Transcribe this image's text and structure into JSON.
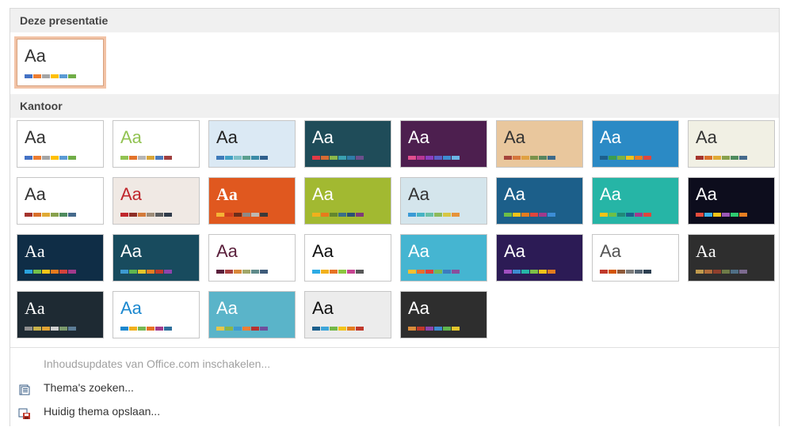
{
  "sections": {
    "current": "Deze presentatie",
    "office": "Kantoor"
  },
  "themes": [
    {
      "aa": "Aa",
      "bg": "#ffffff",
      "fg": "#333333",
      "sw": [
        "#4472c4",
        "#ed7d31",
        "#a5a5a5",
        "#ffc000",
        "#5b9bd5",
        "#70ad47"
      ]
    },
    {
      "aa": "Aa",
      "bg": "#ffffff",
      "fg": "#333333",
      "sw": [
        "#4472c4",
        "#ed7d31",
        "#a5a5a5",
        "#ffc000",
        "#5b9bd5",
        "#70ad47"
      ]
    },
    {
      "aa": "Aa",
      "bg": "#ffffff",
      "fg": "#92c353",
      "sw": [
        "#92c353",
        "#e3732b",
        "#b5b5b5",
        "#d8a63a",
        "#4b7bbc",
        "#9f3f3f"
      ]
    },
    {
      "aa": "Aa",
      "bg": "#dbe9f4",
      "fg": "#222222",
      "sw": [
        "#3e7ab9",
        "#41a0c4",
        "#7cbfc7",
        "#5b9f8f",
        "#3b8ba6",
        "#2f5f8c"
      ]
    },
    {
      "aa": "Aa",
      "bg": "#1f4c59",
      "fg": "#ffffff",
      "sw": [
        "#e23a45",
        "#d76b32",
        "#8bb84b",
        "#3aa0b0",
        "#2e7ca8",
        "#6c4f8c"
      ]
    },
    {
      "aa": "Aa",
      "bg": "#4d1f4f",
      "fg": "#ffffff",
      "sw": [
        "#e04f8e",
        "#b73694",
        "#8a3fc1",
        "#5a60c8",
        "#3d8dd1",
        "#6bb5e6"
      ]
    },
    {
      "aa": "Aa",
      "bg": "#e9c79d",
      "fg": "#333333",
      "sw": [
        "#a5443b",
        "#d6773b",
        "#e0a142",
        "#7b934b",
        "#56855f",
        "#3d6a8a"
      ]
    },
    {
      "aa": "Aa",
      "bg": "#2b8ac5",
      "fg": "#ffffff",
      "sw": [
        "#1c5f8c",
        "#3b9e4f",
        "#7cb342",
        "#f2c318",
        "#ef7c1e",
        "#e0463c"
      ]
    },
    {
      "aa": "Aa",
      "bg": "#f1f0e4",
      "fg": "#333333",
      "sw": [
        "#a5342d",
        "#d96f2a",
        "#e0aa34",
        "#88a14c",
        "#4f8b5e",
        "#466a8c"
      ]
    },
    {
      "aa": "Aa",
      "bg": "#ffffff",
      "fg": "#333333",
      "sw": [
        "#a5342d",
        "#d96f2a",
        "#e0aa34",
        "#88a14c",
        "#4f8b5e",
        "#466a8c"
      ]
    },
    {
      "aa": "Aa",
      "bg": "#f0e9e4",
      "fg": "#c0272d",
      "sw": [
        "#c0272d",
        "#8e2f27",
        "#d37a3a",
        "#9d8c78",
        "#5a5c5e",
        "#2f3b4a"
      ]
    },
    {
      "aa": "Aa",
      "bg": "#e0581f",
      "fg": "#ffffff",
      "sw": [
        "#f5b335",
        "#cf3e1d",
        "#6c2e1a",
        "#8d8a86",
        "#bcb8b3",
        "#3a3a3a"
      ]
    },
    {
      "aa": "Aa",
      "bg": "#a2b931",
      "fg": "#ffffff",
      "sw": [
        "#f1b01c",
        "#e77b1b",
        "#63872d",
        "#3a6f88",
        "#2b5073",
        "#7f3a78"
      ]
    },
    {
      "aa": "Aa",
      "bg": "#d4e5ec",
      "fg": "#333333",
      "sw": [
        "#3a9ad6",
        "#47b3c4",
        "#69c0a8",
        "#8dbb5a",
        "#d7c743",
        "#e6933a"
      ]
    },
    {
      "aa": "Aa",
      "bg": "#1c5f8a",
      "fg": "#ffffff",
      "sw": [
        "#6dbf47",
        "#f2c318",
        "#e47c1e",
        "#e0463c",
        "#a13a8c",
        "#3c8dd6"
      ]
    },
    {
      "aa": "Aa",
      "bg": "#26b5a6",
      "fg": "#ffffff",
      "sw": [
        "#f2c318",
        "#6dbf47",
        "#1f8a78",
        "#1c5f8c",
        "#a13a8c",
        "#e0463c"
      ]
    },
    {
      "aa": "Aa",
      "bg": "#0d0d1d",
      "fg": "#ffffff",
      "sw": [
        "#e64c3c",
        "#3db1e8",
        "#f5c518",
        "#9b59b6",
        "#2ecc71",
        "#e67e22"
      ]
    },
    {
      "aa": "Aa",
      "bg": "#0f2d46",
      "fg": "#ffffff",
      "sw": [
        "#2aa3de",
        "#73c04a",
        "#f5c518",
        "#e57a1e",
        "#d2423c",
        "#a13a8c"
      ]
    },
    {
      "aa": "Aa",
      "bg": "#184b5e",
      "fg": "#ffffff",
      "sw": [
        "#3d9ad1",
        "#5fb64e",
        "#e4c62b",
        "#e67e22",
        "#c0392b",
        "#8e44ad"
      ]
    },
    {
      "aa": "Aa",
      "bg": "#ffffff",
      "fg": "#5a1f3b",
      "sw": [
        "#5a1f3b",
        "#a83e3e",
        "#d9873a",
        "#a1a76a",
        "#5f8a89",
        "#3e5b7a"
      ]
    },
    {
      "aa": "Aa",
      "bg": "#ffffff",
      "fg": "#111111",
      "sw": [
        "#2dabe4",
        "#f1b01c",
        "#e67224",
        "#8cc63f",
        "#c64591",
        "#575757"
      ]
    },
    {
      "aa": "Aa",
      "bg": "#45b5d1",
      "fg": "#ffffff",
      "sw": [
        "#f9c02e",
        "#ea6f2b",
        "#e03e39",
        "#76b852",
        "#3b7cbf",
        "#8a4f9c"
      ]
    },
    {
      "aa": "Aa",
      "bg": "#2c1b55",
      "fg": "#ffffff",
      "sw": [
        "#a14fc0",
        "#3d8bd1",
        "#26b5a6",
        "#7cbf47",
        "#f2c318",
        "#e47c1e"
      ]
    },
    {
      "aa": "Aa",
      "bg": "#ffffff",
      "fg": "#555555",
      "sw": [
        "#c0392b",
        "#d35400",
        "#8e5a3a",
        "#7b7b7b",
        "#566573",
        "#2c3e50"
      ]
    },
    {
      "aa": "Aa",
      "bg": "#2e2e2e",
      "fg": "#ffffff",
      "sw": [
        "#c09a4d",
        "#b26c3a",
        "#8f3f2d",
        "#6e7b48",
        "#4f6f85",
        "#7c6a8f"
      ]
    },
    {
      "aa": "Aa",
      "bg": "#1e2a33",
      "fg": "#ffffff",
      "sw": [
        "#8e8e8e",
        "#c8b24a",
        "#e2a334",
        "#cfcfcf",
        "#7b9a6d",
        "#5c7d97"
      ]
    },
    {
      "aa": "Aa",
      "bg": "#ffffff",
      "fg": "#1c88cf",
      "sw": [
        "#1c88cf",
        "#f1b01c",
        "#76b852",
        "#e67224",
        "#a13a8c",
        "#2f6f9c"
      ]
    },
    {
      "aa": "Aa",
      "bg": "#5ab4c9",
      "fg": "#ffffff",
      "sw": [
        "#e7c64a",
        "#8db548",
        "#3d9ad1",
        "#ed7f34",
        "#b8312f",
        "#6f4e9c"
      ]
    },
    {
      "aa": "Aa",
      "bg": "#ececec",
      "fg": "#111111",
      "sw": [
        "#1c5f8c",
        "#3da5d9",
        "#73b848",
        "#f2c318",
        "#e47c1e",
        "#c0392b"
      ]
    },
    {
      "aa": "Aa",
      "bg": "#2e2e2e",
      "fg": "#ffffff",
      "sw": [
        "#d98b3a",
        "#c0392b",
        "#8e44ad",
        "#3d8bd1",
        "#5fb64e",
        "#e4c62b"
      ]
    }
  ],
  "menu": {
    "updates": "Inhoudsupdates van Office.com inschakelen...",
    "search": "Thema's zoeken...",
    "save": "Huidig thema opslaan..."
  }
}
